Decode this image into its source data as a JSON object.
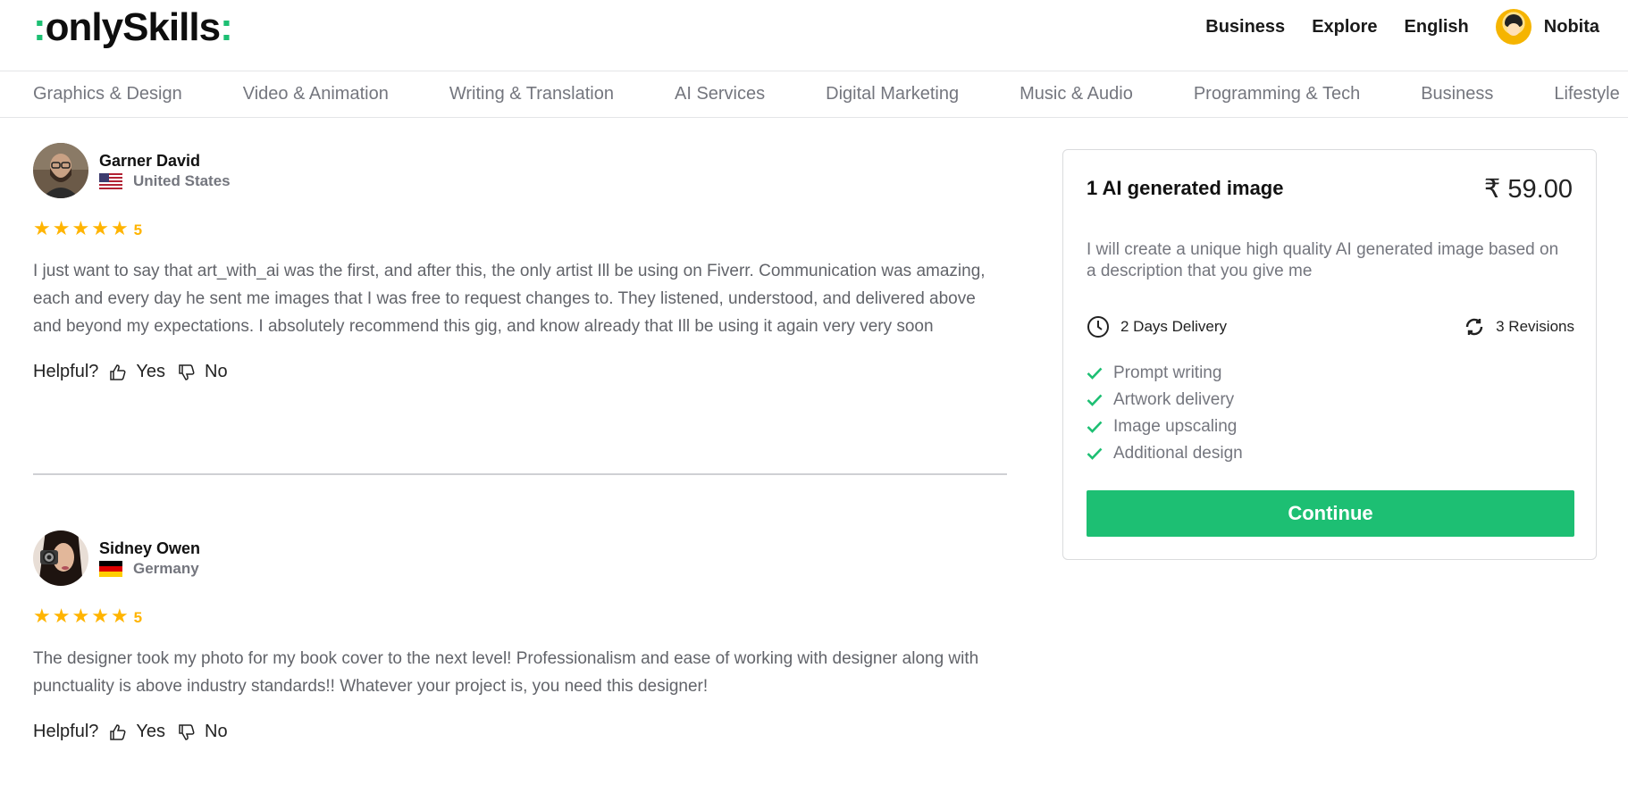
{
  "header": {
    "logo_prefix": ":",
    "logo_text": "onlySkills",
    "logo_suffix": ":",
    "nav": [
      "Business",
      "Explore",
      "English"
    ],
    "user_name": "Nobita"
  },
  "categories": [
    "Graphics & Design",
    "Video & Animation",
    "Writing & Translation",
    "AI Services",
    "Digital Marketing",
    "Music & Audio",
    "Programming & Tech",
    "Business",
    "Lifestyle"
  ],
  "reviews": [
    {
      "name": "Garner David",
      "country": "United States",
      "rating": "5",
      "text": "I just want to say that art_with_ai was the first, and after this, the only artist Ill be using on Fiverr. Communication was amazing, each and every day he sent me images that I was free to request changes to. They listened, understood, and delivered above and beyond my expectations. I absolutely recommend this gig, and know already that Ill be using it again very very soon"
    },
    {
      "name": "Sidney Owen",
      "country": "Germany",
      "rating": "5",
      "text": "The designer took my photo for my book cover to the next level! Professionalism and ease of working with designer along with punctuality is above industry standards!! Whatever your project is, you need this designer!"
    }
  ],
  "helpful": {
    "label": "Helpful?",
    "yes": "Yes",
    "no": "No"
  },
  "package": {
    "title": "1 AI generated image",
    "price": "₹ 59.00",
    "description": "I will create a unique high quality AI generated image based on a description that you give me",
    "delivery": "2 Days Delivery",
    "revisions": "3 Revisions",
    "features": [
      "Prompt writing",
      "Artwork delivery",
      "Image upscaling",
      "Additional design"
    ],
    "cta": "Continue"
  },
  "colors": {
    "brand": "#1dbf73",
    "star": "#ffb400",
    "muted": "#74767e"
  }
}
